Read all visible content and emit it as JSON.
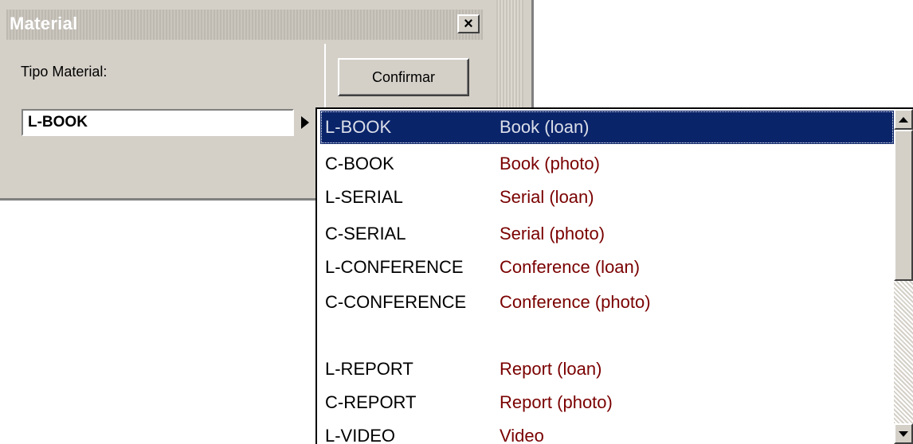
{
  "dialog": {
    "title": "Material",
    "close_glyph": "×",
    "label": "Tipo Material:",
    "confirm_label": "Confirmar",
    "combo_value": "L-BOOK"
  },
  "dropdown": {
    "items": [
      {
        "code": "L-BOOK",
        "desc": "Book (loan)",
        "selected": true
      },
      {
        "code": "C-BOOK",
        "desc": "Book (photo)"
      },
      {
        "code": "L-SERIAL",
        "desc": "Serial (loan)"
      },
      {
        "code": "C-SERIAL",
        "desc": "Serial (photo)"
      },
      {
        "code": "L-CONFERENCE",
        "desc": "Conference (loan)"
      },
      {
        "code": "C-CONFERENCE",
        "desc": "Conference (photo)"
      },
      {
        "code": "L-REPORT",
        "desc": "Report (loan)"
      },
      {
        "code": "C-REPORT",
        "desc": "Report (photo)"
      },
      {
        "code": "L-VIDEO",
        "desc": "Video"
      }
    ]
  },
  "colors": {
    "selection": "#0a246a",
    "description_text": "#7a0000",
    "window_face": "#d4d0c8"
  }
}
